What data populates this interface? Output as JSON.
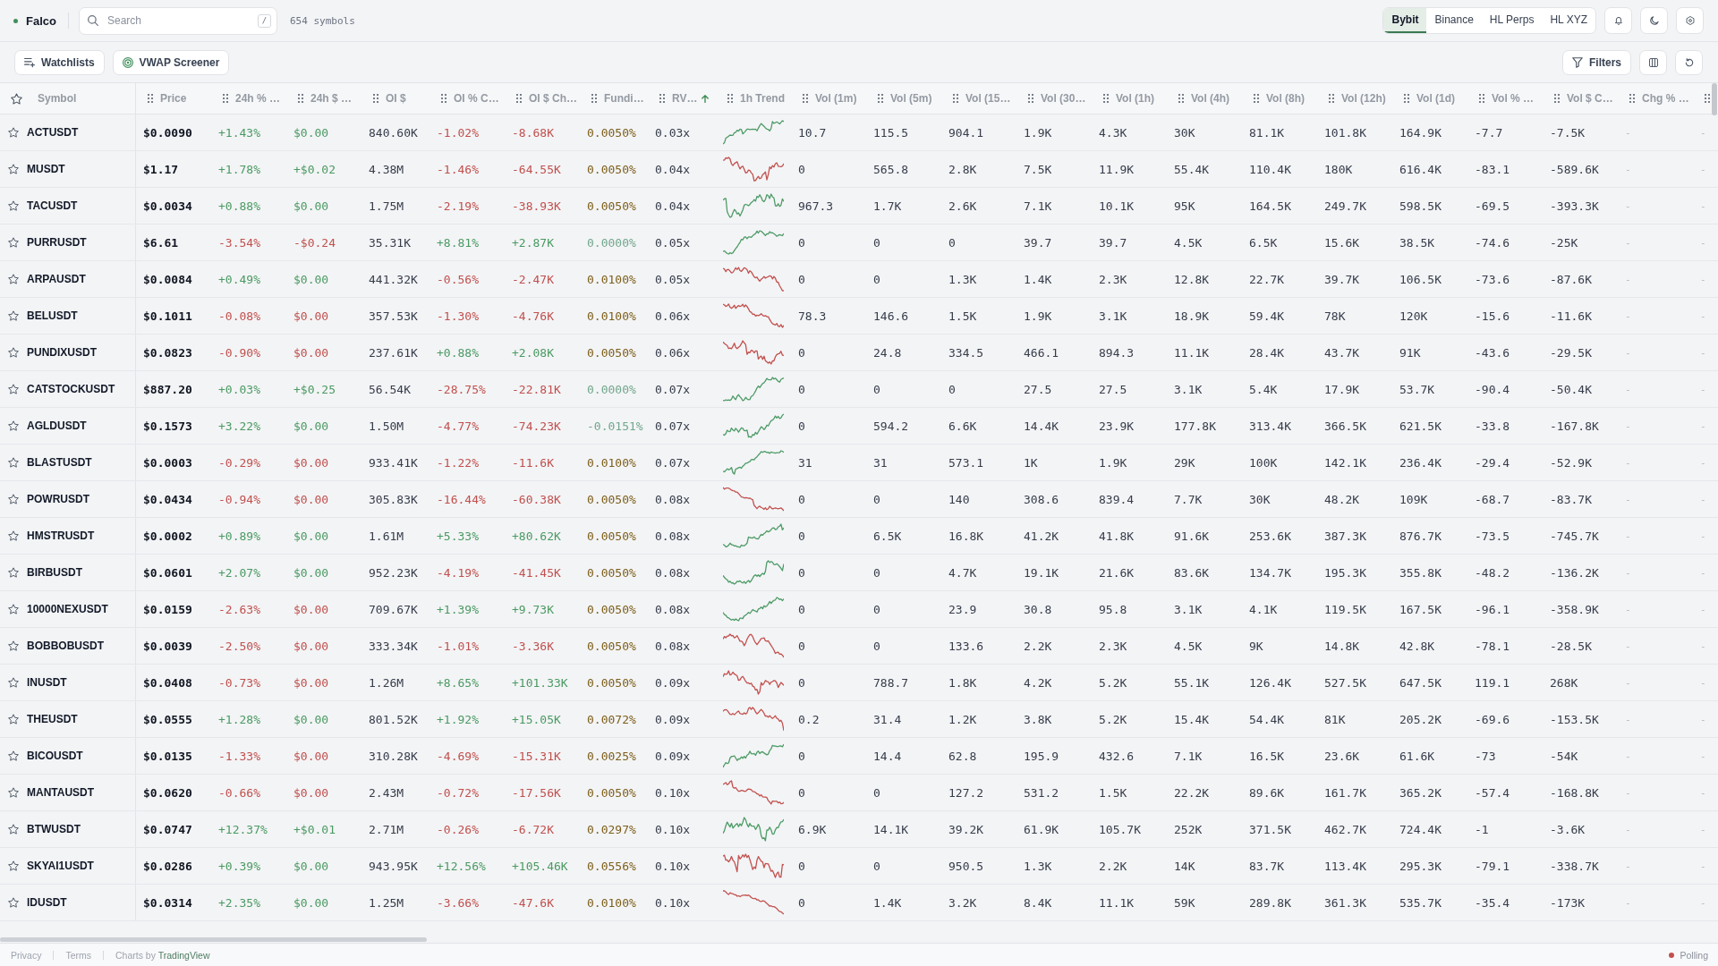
{
  "brand": {
    "name": "Falco"
  },
  "search": {
    "placeholder": "Search",
    "shortcut": "/"
  },
  "symbol_count": "654 symbols",
  "exchanges": [
    {
      "label": "Bybit",
      "selected": true
    },
    {
      "label": "Binance",
      "selected": false
    },
    {
      "label": "HL Perps",
      "selected": false
    },
    {
      "label": "HL XYZ",
      "selected": false
    }
  ],
  "toolbar": {
    "buttons": [
      "Watchlists",
      "VWAP Screener"
    ],
    "filters": "Filters"
  },
  "table": {
    "symbol_column": "Symbol",
    "columns": [
      {
        "label": "Price",
        "kind": "price",
        "sorted": false
      },
      {
        "label": "24h % …",
        "kind": "price_change",
        "sorted": false
      },
      {
        "label": "24h $ …",
        "kind": "price_change",
        "sorted": false
      },
      {
        "label": "OI $",
        "kind": "plain",
        "sorted": false
      },
      {
        "label": "OI % C…",
        "kind": "oi_change",
        "sorted": false
      },
      {
        "label": "OI $ Ch…",
        "kind": "oi_change",
        "sorted": false
      },
      {
        "label": "Fundi…",
        "kind": "funding",
        "sorted": false
      },
      {
        "label": "RV…",
        "kind": "plain",
        "sorted": true,
        "ascending": true
      },
      {
        "label": "1h Trend",
        "kind": "trend",
        "sorted": false
      },
      {
        "label": "Vol (1m)",
        "kind": "plain",
        "sorted": false
      },
      {
        "label": "Vol (5m)",
        "kind": "plain",
        "sorted": false
      },
      {
        "label": "Vol (15…",
        "kind": "plain",
        "sorted": false
      },
      {
        "label": "Vol (30…",
        "kind": "plain",
        "sorted": false
      },
      {
        "label": "Vol (1h)",
        "kind": "plain",
        "sorted": false
      },
      {
        "label": "Vol (4h)",
        "kind": "plain",
        "sorted": false
      },
      {
        "label": "Vol (8h)",
        "kind": "plain",
        "sorted": false
      },
      {
        "label": "Vol (12h)",
        "kind": "plain",
        "sorted": false
      },
      {
        "label": "Vol (1d)",
        "kind": "plain",
        "sorted": false
      },
      {
        "label": "Vol % …",
        "kind": "plain",
        "sorted": false
      },
      {
        "label": "Vol $ C…",
        "kind": "plain",
        "sorted": false
      },
      {
        "label": "Chg % …",
        "kind": "muted",
        "sorted": false
      },
      {
        "kind": "muted"
      }
    ],
    "rows": [
      {
        "symbol": "ACTUSDT",
        "starred": false,
        "price_rising": true,
        "oi_rising": false,
        "funding_positive": true,
        "trend_rising": true,
        "values": [
          "$0.0090",
          "+1.43%",
          "$0.00",
          "840.60K",
          "-1.02%",
          "-8.68K",
          "0.0050%",
          "0.03x",
          "10.7",
          "115.5",
          "904.1",
          "1.9K",
          "4.3K",
          "30K",
          "81.1K",
          "101.8K",
          "164.9K",
          "-7.7",
          "-7.5K",
          "-",
          "-"
        ]
      },
      {
        "symbol": "MUSDT",
        "starred": false,
        "price_rising": true,
        "oi_rising": false,
        "funding_positive": true,
        "trend_rising": false,
        "values": [
          "$1.17",
          "+1.78%",
          "+$0.02",
          "4.38M",
          "-1.46%",
          "-64.55K",
          "0.0050%",
          "0.04x",
          "0",
          "565.8",
          "2.8K",
          "7.5K",
          "11.9K",
          "55.4K",
          "110.4K",
          "180K",
          "616.4K",
          "-83.1",
          "-589.6K",
          "-",
          "-"
        ]
      },
      {
        "symbol": "TACUSDT",
        "starred": false,
        "price_rising": true,
        "oi_rising": false,
        "funding_positive": true,
        "trend_rising": true,
        "values": [
          "$0.0034",
          "+0.88%",
          "$0.00",
          "1.75M",
          "-2.19%",
          "-38.93K",
          "0.0050%",
          "0.04x",
          "967.3",
          "1.7K",
          "2.6K",
          "7.1K",
          "10.1K",
          "95K",
          "164.5K",
          "249.7K",
          "598.5K",
          "-69.5",
          "-393.3K",
          "-",
          "-"
        ]
      },
      {
        "symbol": "PURRUSDT",
        "starred": false,
        "price_rising": false,
        "oi_rising": true,
        "funding_positive": false,
        "trend_rising": true,
        "values": [
          "$6.61",
          "-3.54%",
          "-$0.24",
          "35.31K",
          "+8.81%",
          "+2.87K",
          "0.0000%",
          "0.05x",
          "0",
          "0",
          "0",
          "39.7",
          "39.7",
          "4.5K",
          "6.5K",
          "15.6K",
          "38.5K",
          "-74.6",
          "-25K",
          "-",
          "-"
        ]
      },
      {
        "symbol": "ARPAUSDT",
        "starred": false,
        "price_rising": true,
        "oi_rising": false,
        "funding_positive": true,
        "trend_rising": false,
        "values": [
          "$0.0084",
          "+0.49%",
          "$0.00",
          "441.32K",
          "-0.56%",
          "-2.47K",
          "0.0100%",
          "0.05x",
          "0",
          "0",
          "1.3K",
          "1.4K",
          "2.3K",
          "12.8K",
          "22.7K",
          "39.7K",
          "106.5K",
          "-73.6",
          "-87.6K",
          "-",
          "-"
        ]
      },
      {
        "symbol": "BELUSDT",
        "starred": false,
        "price_rising": false,
        "oi_rising": false,
        "funding_positive": true,
        "trend_rising": false,
        "values": [
          "$0.1011",
          "-0.08%",
          "$0.00",
          "357.53K",
          "-1.30%",
          "-4.76K",
          "0.0100%",
          "0.06x",
          "78.3",
          "146.6",
          "1.5K",
          "1.9K",
          "3.1K",
          "18.9K",
          "59.4K",
          "78K",
          "120K",
          "-15.6",
          "-11.6K",
          "-",
          "-"
        ]
      },
      {
        "symbol": "PUNDIXUSDT",
        "starred": false,
        "price_rising": false,
        "oi_rising": true,
        "funding_positive": true,
        "trend_rising": false,
        "values": [
          "$0.0823",
          "-0.90%",
          "$0.00",
          "237.61K",
          "+0.88%",
          "+2.08K",
          "0.0050%",
          "0.06x",
          "0",
          "24.8",
          "334.5",
          "466.1",
          "894.3",
          "11.1K",
          "28.4K",
          "43.7K",
          "91K",
          "-43.6",
          "-29.5K",
          "-",
          "-"
        ]
      },
      {
        "symbol": "CATSTOCKUSDT",
        "starred": false,
        "price_rising": true,
        "oi_rising": false,
        "funding_positive": false,
        "trend_rising": true,
        "values": [
          "$887.20",
          "+0.03%",
          "+$0.25",
          "56.54K",
          "-28.75%",
          "-22.81K",
          "0.0000%",
          "0.07x",
          "0",
          "0",
          "0",
          "27.5",
          "27.5",
          "3.1K",
          "5.4K",
          "17.9K",
          "53.7K",
          "-90.4",
          "-50.4K",
          "-",
          "-"
        ]
      },
      {
        "symbol": "AGLDUSDT",
        "starred": false,
        "price_rising": true,
        "oi_rising": false,
        "funding_positive": false,
        "trend_rising": true,
        "values": [
          "$0.1573",
          "+3.22%",
          "$0.00",
          "1.50M",
          "-4.77%",
          "-74.23K",
          "-0.0151%",
          "0.07x",
          "0",
          "594.2",
          "6.6K",
          "14.4K",
          "23.9K",
          "177.8K",
          "313.4K",
          "366.5K",
          "621.5K",
          "-33.8",
          "-167.8K",
          "-",
          "-"
        ]
      },
      {
        "symbol": "BLASTUSDT",
        "starred": false,
        "price_rising": false,
        "oi_rising": false,
        "funding_positive": true,
        "trend_rising": true,
        "values": [
          "$0.0003",
          "-0.29%",
          "$0.00",
          "933.41K",
          "-1.22%",
          "-11.6K",
          "0.0100%",
          "0.07x",
          "31",
          "31",
          "573.1",
          "1K",
          "1.9K",
          "29K",
          "100K",
          "142.1K",
          "236.4K",
          "-29.4",
          "-52.9K",
          "-",
          "-"
        ]
      },
      {
        "symbol": "POWRUSDT",
        "starred": false,
        "price_rising": false,
        "oi_rising": false,
        "funding_positive": true,
        "trend_rising": false,
        "values": [
          "$0.0434",
          "-0.94%",
          "$0.00",
          "305.83K",
          "-16.44%",
          "-60.38K",
          "0.0050%",
          "0.08x",
          "0",
          "0",
          "140",
          "308.6",
          "839.4",
          "7.7K",
          "30K",
          "48.2K",
          "109K",
          "-68.7",
          "-83.7K",
          "-",
          "-"
        ]
      },
      {
        "symbol": "HMSTRUSDT",
        "starred": false,
        "price_rising": true,
        "oi_rising": true,
        "funding_positive": true,
        "trend_rising": true,
        "values": [
          "$0.0002",
          "+0.89%",
          "$0.00",
          "1.61M",
          "+5.33%",
          "+80.62K",
          "0.0050%",
          "0.08x",
          "0",
          "6.5K",
          "16.8K",
          "41.2K",
          "41.8K",
          "91.6K",
          "253.6K",
          "387.3K",
          "876.7K",
          "-73.5",
          "-745.7K",
          "-",
          "-"
        ]
      },
      {
        "symbol": "BIRBUSDT",
        "starred": false,
        "price_rising": true,
        "oi_rising": false,
        "funding_positive": true,
        "trend_rising": true,
        "values": [
          "$0.0601",
          "+2.07%",
          "$0.00",
          "952.23K",
          "-4.19%",
          "-41.45K",
          "0.0050%",
          "0.08x",
          "0",
          "0",
          "4.7K",
          "19.1K",
          "21.6K",
          "83.6K",
          "134.7K",
          "195.3K",
          "355.8K",
          "-48.2",
          "-136.2K",
          "-",
          "-"
        ]
      },
      {
        "symbol": "10000NEXUSDT",
        "starred": false,
        "price_rising": false,
        "oi_rising": true,
        "funding_positive": true,
        "trend_rising": true,
        "values": [
          "$0.0159",
          "-2.63%",
          "$0.00",
          "709.67K",
          "+1.39%",
          "+9.73K",
          "0.0050%",
          "0.08x",
          "0",
          "0",
          "23.9",
          "30.8",
          "95.8",
          "3.1K",
          "4.1K",
          "119.5K",
          "167.5K",
          "-96.1",
          "-358.9K",
          "-",
          "-"
        ]
      },
      {
        "symbol": "BOBBOBUSDT",
        "starred": false,
        "price_rising": false,
        "oi_rising": false,
        "funding_positive": true,
        "trend_rising": false,
        "values": [
          "$0.0039",
          "-2.50%",
          "$0.00",
          "333.34K",
          "-1.01%",
          "-3.36K",
          "0.0050%",
          "0.08x",
          "0",
          "0",
          "133.6",
          "2.2K",
          "2.3K",
          "4.5K",
          "9K",
          "14.8K",
          "42.8K",
          "-78.1",
          "-28.5K",
          "-",
          "-"
        ]
      },
      {
        "symbol": "INUSDT",
        "starred": false,
        "price_rising": false,
        "oi_rising": true,
        "funding_positive": true,
        "trend_rising": false,
        "values": [
          "$0.0408",
          "-0.73%",
          "$0.00",
          "1.26M",
          "+8.65%",
          "+101.33K",
          "0.0050%",
          "0.09x",
          "0",
          "788.7",
          "1.8K",
          "4.2K",
          "5.2K",
          "55.1K",
          "126.4K",
          "527.5K",
          "647.5K",
          "119.1",
          "268K",
          "-",
          "-"
        ]
      },
      {
        "symbol": "THEUSDT",
        "starred": false,
        "price_rising": true,
        "oi_rising": true,
        "funding_positive": true,
        "trend_rising": false,
        "values": [
          "$0.0555",
          "+1.28%",
          "$0.00",
          "801.52K",
          "+1.92%",
          "+15.05K",
          "0.0072%",
          "0.09x",
          "0.2",
          "31.4",
          "1.2K",
          "3.8K",
          "5.2K",
          "15.4K",
          "54.4K",
          "81K",
          "205.2K",
          "-69.6",
          "-153.5K",
          "-",
          "-"
        ]
      },
      {
        "symbol": "BICOUSDT",
        "starred": false,
        "price_rising": false,
        "oi_rising": false,
        "funding_positive": true,
        "trend_rising": true,
        "values": [
          "$0.0135",
          "-1.33%",
          "$0.00",
          "310.28K",
          "-4.69%",
          "-15.31K",
          "0.0025%",
          "0.09x",
          "0",
          "14.4",
          "62.8",
          "195.9",
          "432.6",
          "7.1K",
          "16.5K",
          "23.6K",
          "61.6K",
          "-73",
          "-54K",
          "-",
          "-"
        ]
      },
      {
        "symbol": "MANTAUSDT",
        "starred": false,
        "price_rising": false,
        "oi_rising": false,
        "funding_positive": true,
        "trend_rising": false,
        "values": [
          "$0.0620",
          "-0.66%",
          "$0.00",
          "2.43M",
          "-0.72%",
          "-17.56K",
          "0.0050%",
          "0.10x",
          "0",
          "0",
          "127.2",
          "531.2",
          "1.5K",
          "22.2K",
          "89.6K",
          "161.7K",
          "365.2K",
          "-57.4",
          "-168.8K",
          "-",
          "-"
        ]
      },
      {
        "symbol": "BTWUSDT",
        "starred": false,
        "price_rising": true,
        "oi_rising": false,
        "funding_positive": true,
        "trend_rising": true,
        "values": [
          "$0.0747",
          "+12.37%",
          "+$0.01",
          "2.71M",
          "-0.26%",
          "-6.72K",
          "0.0297%",
          "0.10x",
          "6.9K",
          "14.1K",
          "39.2K",
          "61.9K",
          "105.7K",
          "252K",
          "371.5K",
          "462.7K",
          "724.4K",
          "-1",
          "-3.6K",
          "-",
          "-"
        ]
      },
      {
        "symbol": "SKYAI1USDT",
        "starred": false,
        "price_rising": true,
        "oi_rising": true,
        "funding_positive": true,
        "trend_rising": false,
        "values": [
          "$0.0286",
          "+0.39%",
          "$0.00",
          "943.95K",
          "+12.56%",
          "+105.46K",
          "0.0556%",
          "0.10x",
          "0",
          "0",
          "950.5",
          "1.3K",
          "2.2K",
          "14K",
          "83.7K",
          "113.4K",
          "295.3K",
          "-79.1",
          "-338.7K",
          "-",
          "-"
        ]
      },
      {
        "symbol": "IDUSDT",
        "starred": false,
        "price_rising": true,
        "oi_rising": false,
        "funding_positive": true,
        "trend_rising": false,
        "values": [
          "$0.0314",
          "+2.35%",
          "$0.00",
          "1.25M",
          "-3.66%",
          "-47.6K",
          "0.0100%",
          "0.10x",
          "0",
          "1.4K",
          "3.2K",
          "8.4K",
          "11.1K",
          "59K",
          "289.8K",
          "361.3K",
          "535.7K",
          "-35.4",
          "-173K",
          "-",
          "-"
        ]
      }
    ]
  },
  "footer": {
    "links": [
      "Privacy",
      "Terms"
    ],
    "credit": {
      "text": "Charts by",
      "link": "TradingView"
    },
    "status": "Polling"
  }
}
